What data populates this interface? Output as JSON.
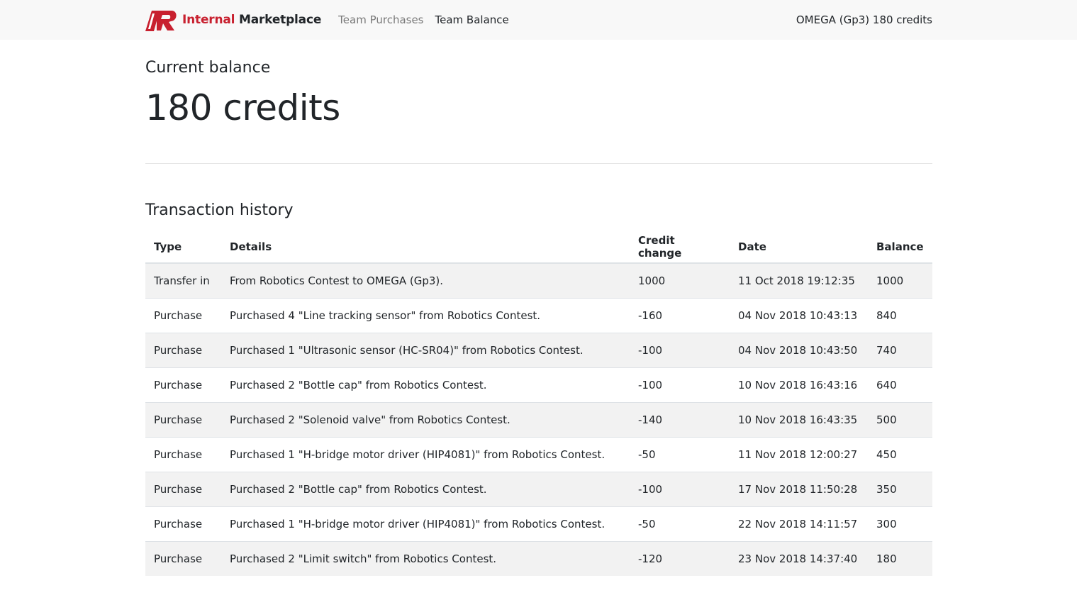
{
  "navbar": {
    "brand_accent": "Internal",
    "brand_rest": " Marketplace",
    "links": [
      {
        "label": "Team Purchases",
        "active": false
      },
      {
        "label": "Team Balance",
        "active": true
      }
    ],
    "team_status": "OMEGA (Gp3) 180 credits"
  },
  "colors": {
    "brand_red": "#c8202f",
    "navbar_bg": "#f8f8f8",
    "stripe_bg": "#f2f2f2"
  },
  "balance": {
    "label": "Current balance",
    "value": "180 credits"
  },
  "history": {
    "title": "Transaction history",
    "columns": [
      "Type",
      "Details",
      "Credit change",
      "Date",
      "Balance"
    ],
    "rows": [
      {
        "type": "Transfer in",
        "details": "From Robotics Contest to OMEGA (Gp3).",
        "credit_change": "1000",
        "date": "11 Oct 2018 19:12:35",
        "balance": "1000"
      },
      {
        "type": "Purchase",
        "details": "Purchased 4 \"Line tracking sensor\" from Robotics Contest.",
        "credit_change": "-160",
        "date": "04 Nov 2018 10:43:13",
        "balance": "840"
      },
      {
        "type": "Purchase",
        "details": "Purchased 1 \"Ultrasonic sensor (HC-SR04)\" from Robotics Contest.",
        "credit_change": "-100",
        "date": "04 Nov 2018 10:43:50",
        "balance": "740"
      },
      {
        "type": "Purchase",
        "details": "Purchased 2 \"Bottle cap\" from Robotics Contest.",
        "credit_change": "-100",
        "date": "10 Nov 2018 16:43:16",
        "balance": "640"
      },
      {
        "type": "Purchase",
        "details": "Purchased 2 \"Solenoid valve\" from Robotics Contest.",
        "credit_change": "-140",
        "date": "10 Nov 2018 16:43:35",
        "balance": "500"
      },
      {
        "type": "Purchase",
        "details": "Purchased 1 \"H-bridge motor driver (HIP4081)\" from Robotics Contest.",
        "credit_change": "-50",
        "date": "11 Nov 2018 12:00:27",
        "balance": "450"
      },
      {
        "type": "Purchase",
        "details": "Purchased 2 \"Bottle cap\" from Robotics Contest.",
        "credit_change": "-100",
        "date": "17 Nov 2018 11:50:28",
        "balance": "350"
      },
      {
        "type": "Purchase",
        "details": "Purchased 1 \"H-bridge motor driver (HIP4081)\" from Robotics Contest.",
        "credit_change": "-50",
        "date": "22 Nov 2018 14:11:57",
        "balance": "300"
      },
      {
        "type": "Purchase",
        "details": "Purchased 2 \"Limit switch\" from Robotics Contest.",
        "credit_change": "-120",
        "date": "23 Nov 2018 14:37:40",
        "balance": "180"
      }
    ]
  }
}
